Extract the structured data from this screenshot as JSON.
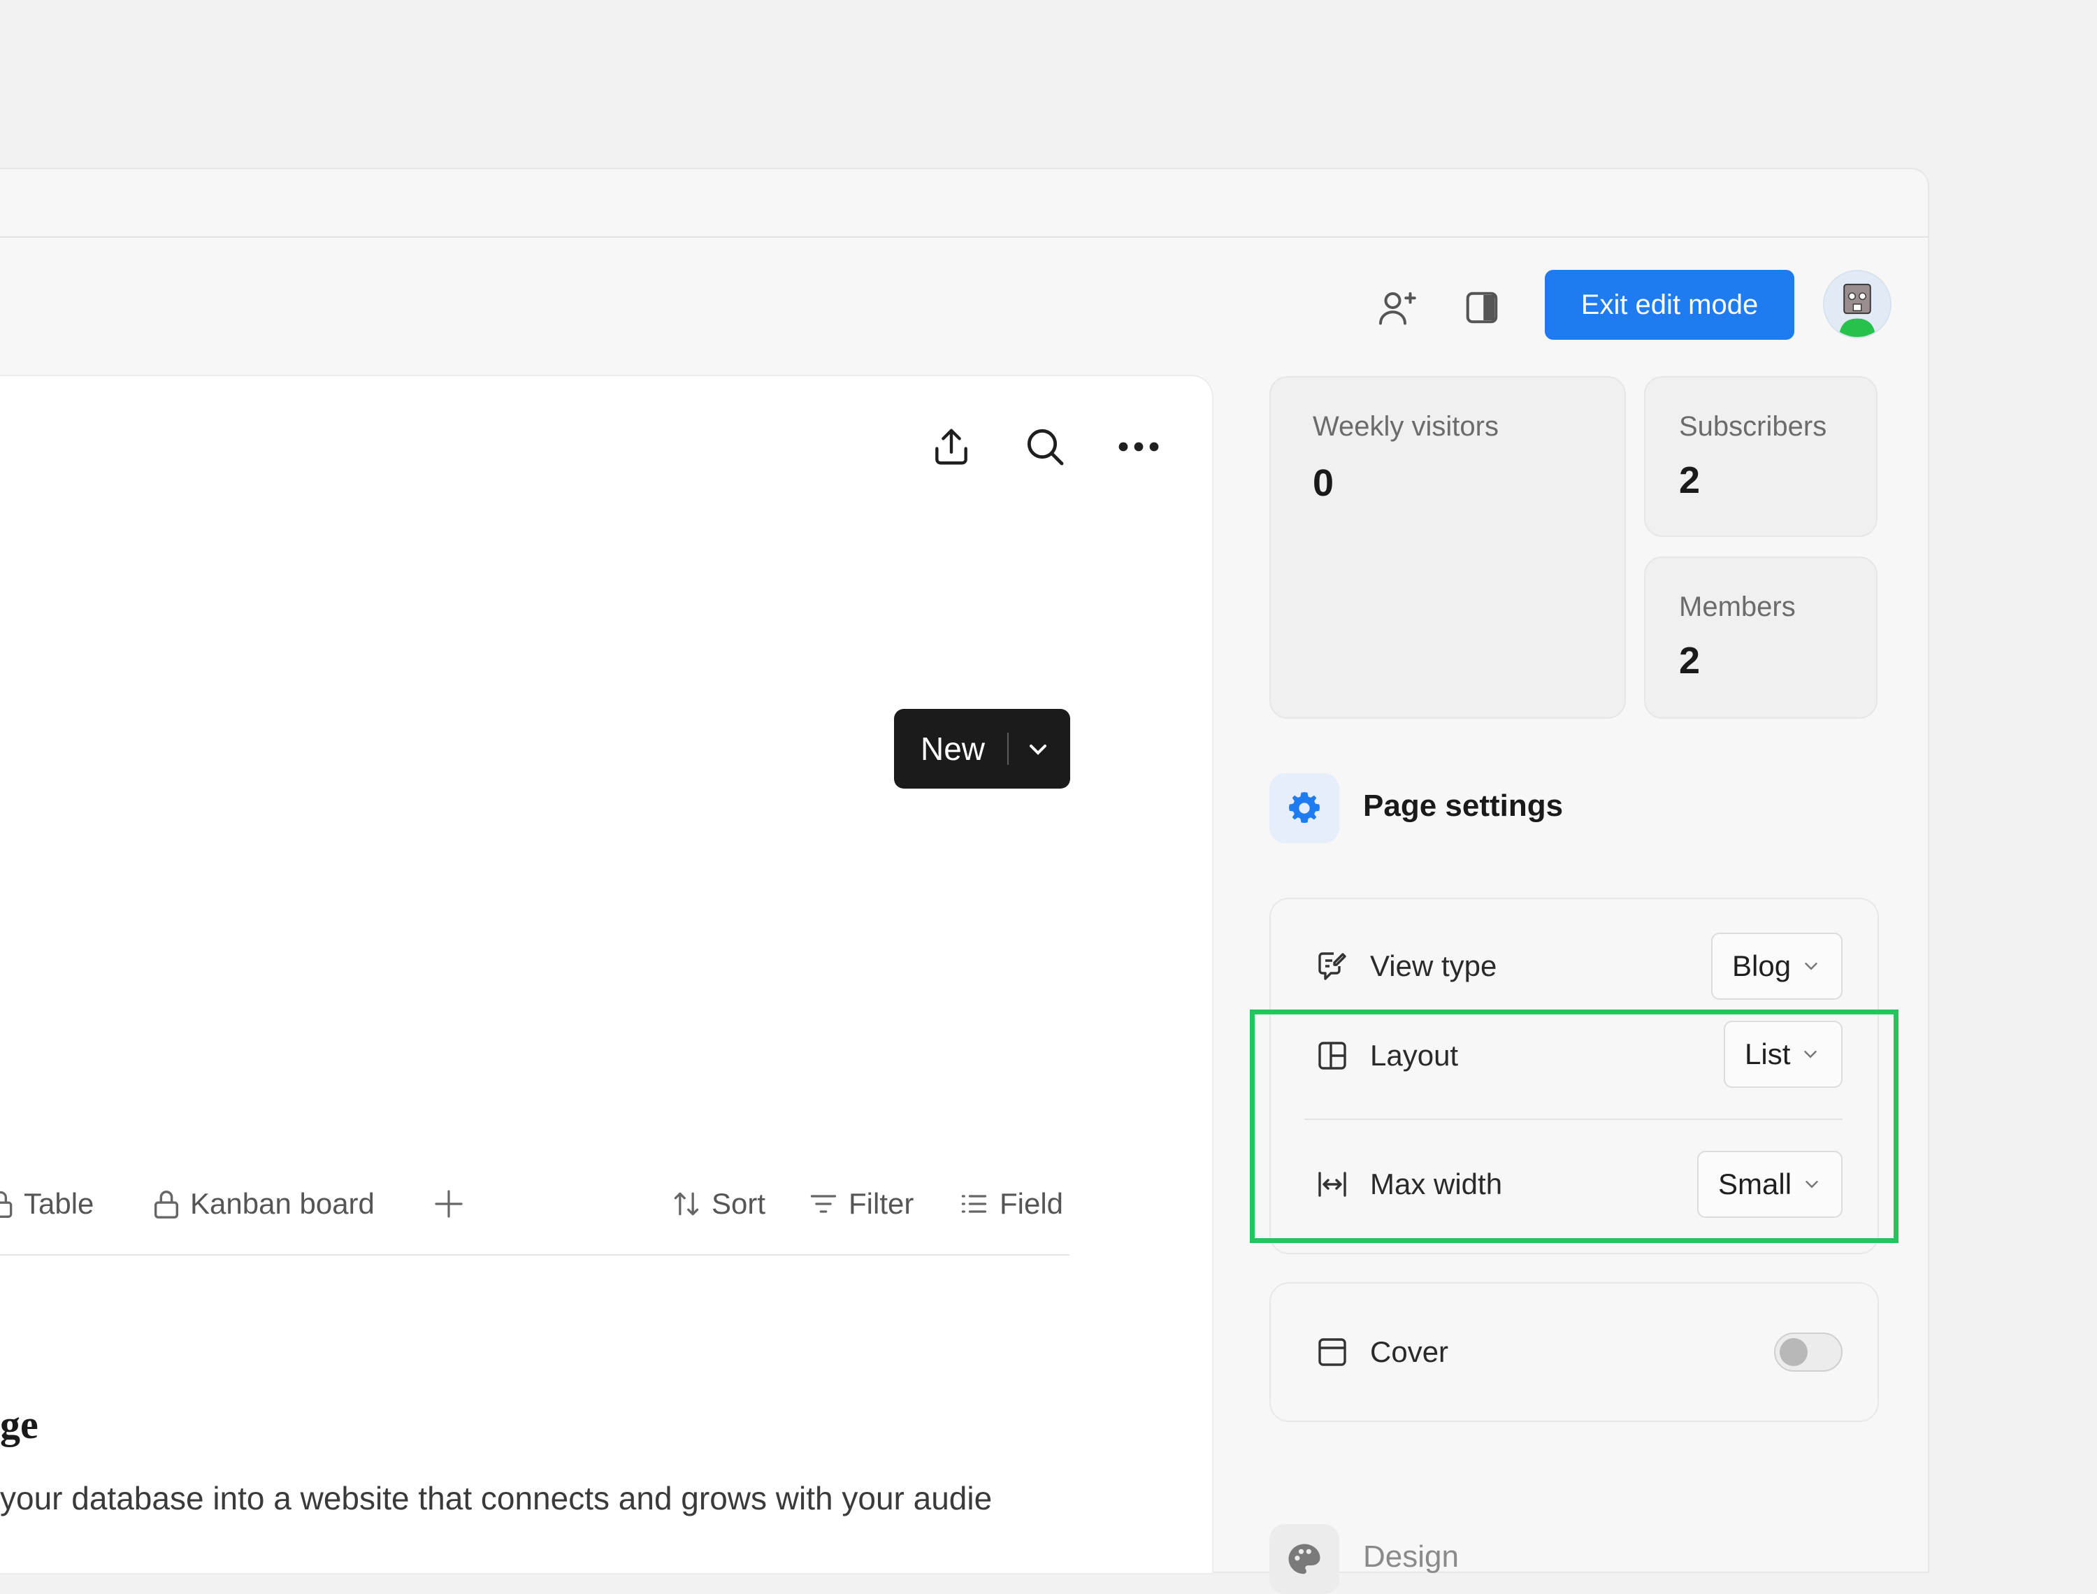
{
  "header": {
    "exit_label": "Exit edit mode"
  },
  "toolbar": {
    "new_label": "New"
  },
  "views": {
    "tabs": [
      {
        "label": "Table"
      },
      {
        "label": "Kanban board"
      }
    ],
    "sort_label": "Sort",
    "filter_label": "Filter",
    "field_label": "Field"
  },
  "content": {
    "heading_fragment": "ge",
    "body_fragment": "your database into a website that connects and grows with your audie"
  },
  "stats": {
    "weekly_visitors": {
      "title": "Weekly visitors",
      "value": "0"
    },
    "subscribers": {
      "title": "Subscribers",
      "value": "2"
    },
    "members": {
      "title": "Members",
      "value": "2"
    }
  },
  "page_settings": {
    "title": "Page settings",
    "view_type": {
      "label": "View type",
      "value": "Blog"
    },
    "layout": {
      "label": "Layout",
      "value": "List"
    },
    "max_width": {
      "label": "Max width",
      "value": "Small"
    },
    "cover": {
      "label": "Cover",
      "enabled": false
    }
  },
  "design": {
    "title": "Design"
  },
  "colors": {
    "accent": "#1f7cf0",
    "highlight": "#22c55e",
    "primary_button": "#1b1b1b"
  }
}
